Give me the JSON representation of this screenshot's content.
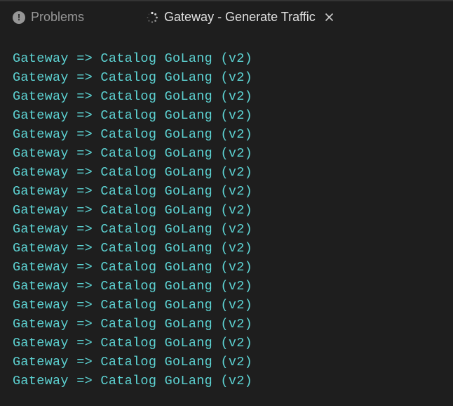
{
  "tabs": {
    "problems": {
      "label": "Problems"
    },
    "terminal": {
      "label": "Gateway - Generate Traffic"
    }
  },
  "terminal": {
    "lines": [
      "Gateway => Catalog GoLang (v2)",
      "Gateway => Catalog GoLang (v2)",
      "Gateway => Catalog GoLang (v2)",
      "Gateway => Catalog GoLang (v2)",
      "Gateway => Catalog GoLang (v2)",
      "Gateway => Catalog GoLang (v2)",
      "Gateway => Catalog GoLang (v2)",
      "Gateway => Catalog GoLang (v2)",
      "Gateway => Catalog GoLang (v2)",
      "Gateway => Catalog GoLang (v2)",
      "Gateway => Catalog GoLang (v2)",
      "Gateway => Catalog GoLang (v2)",
      "Gateway => Catalog GoLang (v2)",
      "Gateway => Catalog GoLang (v2)",
      "Gateway => Catalog GoLang (v2)",
      "Gateway => Catalog GoLang (v2)",
      "Gateway => Catalog GoLang (v2)",
      "Gateway => Catalog GoLang (v2)"
    ]
  }
}
